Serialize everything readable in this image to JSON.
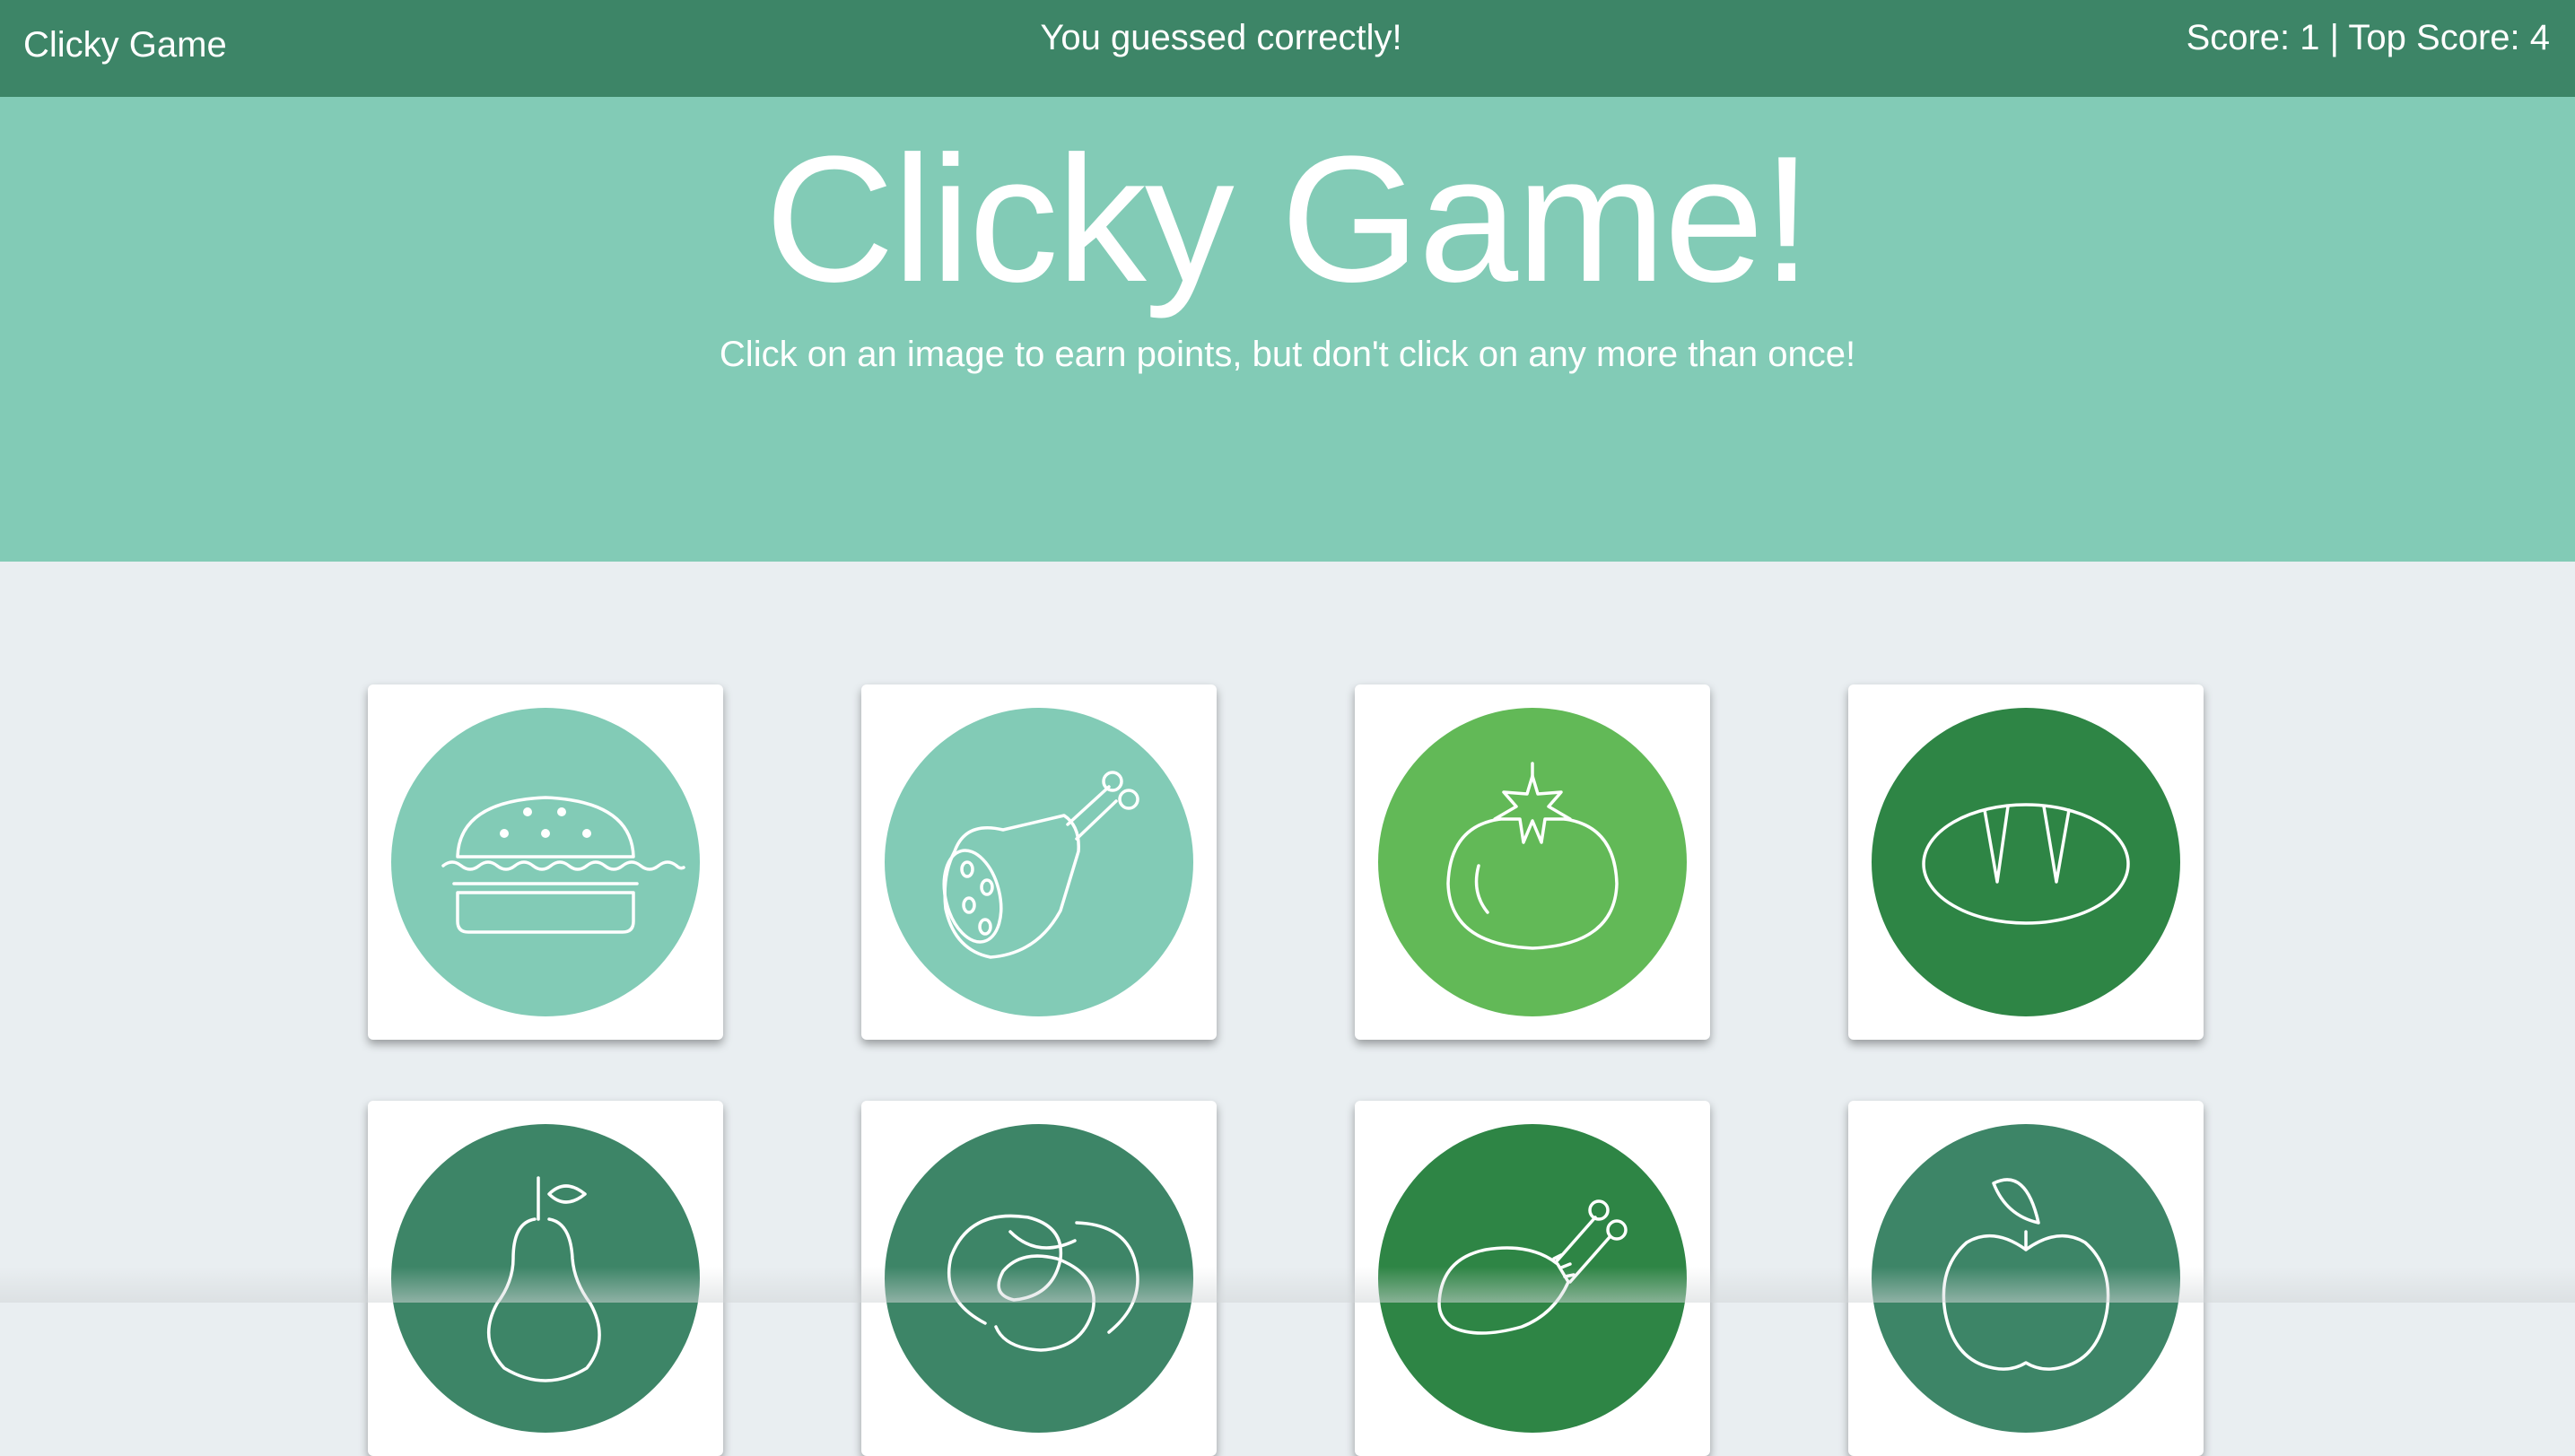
{
  "navbar": {
    "brand": "Clicky Game",
    "message": "You guessed correctly!",
    "score_text": "Score: 1 | Top Score: 4"
  },
  "hero": {
    "title": "Clicky Game!",
    "subtitle": "Click on an image to earn points, but don't click on any more than once!"
  },
  "colors": {
    "navbar": "#3d8567",
    "hero": "#82cbb6",
    "page_background": "#e9eef1",
    "card_background": "#ffffff"
  },
  "cards": [
    {
      "icon": "burger-icon",
      "circle_color": "#82cbb6"
    },
    {
      "icon": "ham-leg-icon",
      "circle_color": "#82cbb6"
    },
    {
      "icon": "tomato-icon",
      "circle_color": "#62b957"
    },
    {
      "icon": "bread-icon",
      "circle_color": "#2e8545"
    },
    {
      "icon": "pear-icon",
      "circle_color": "#3d8567"
    },
    {
      "icon": "pretzel-icon",
      "circle_color": "#3d8567"
    },
    {
      "icon": "chicken-leg-icon",
      "circle_color": "#2e8545"
    },
    {
      "icon": "apple-icon",
      "circle_color": "#3d8567"
    }
  ]
}
